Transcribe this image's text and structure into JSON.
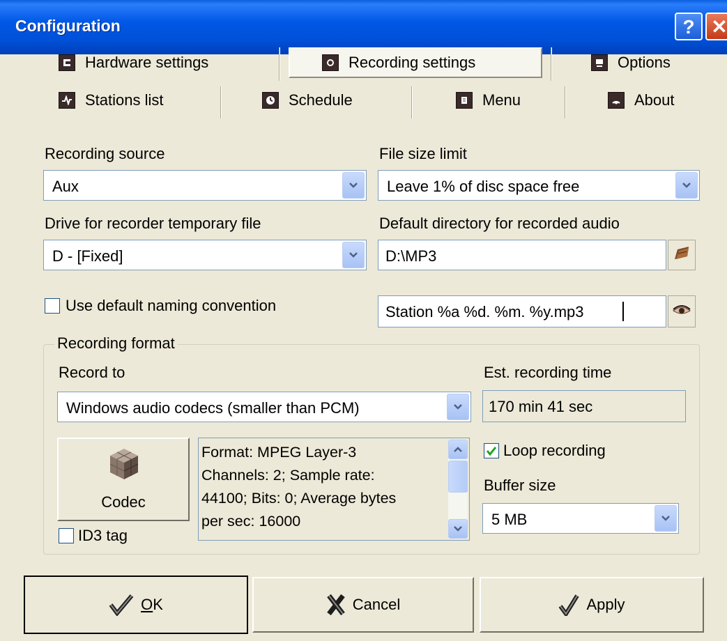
{
  "window": {
    "title": "Configuration",
    "help_glyph": "?",
    "close_glyph": "✕"
  },
  "tabs": [
    {
      "label": "Hardware settings",
      "icon": "hardware-icon",
      "active": false
    },
    {
      "label": "Recording settings",
      "icon": "record-icon",
      "active": true
    },
    {
      "label": "Options",
      "icon": "monitor-icon",
      "active": false
    },
    {
      "label": "Stations list",
      "icon": "pulse-icon",
      "active": false
    },
    {
      "label": "Schedule",
      "icon": "clock-icon",
      "active": false
    },
    {
      "label": "Menu",
      "icon": "menu-icon",
      "active": false
    },
    {
      "label": "About",
      "icon": "signal-icon",
      "active": false
    }
  ],
  "recording_source": {
    "label": "Recording source",
    "value": "Aux"
  },
  "file_size_limit": {
    "label": "File size limit",
    "value": "Leave 1% of disc space free"
  },
  "temp_drive": {
    "label": "Drive for recorder temporary file",
    "value": "D - [Fixed]"
  },
  "default_directory": {
    "label": "Default directory for recorded audio",
    "value": "D:\\MP3"
  },
  "naming": {
    "checkbox_label": "Use default naming convention",
    "checked": false,
    "pattern": "Station %a %d. %m. %y.mp3"
  },
  "recording_format": {
    "group_title": "Recording format",
    "record_to_label": "Record to",
    "record_to_value": "Windows audio codecs (smaller than PCM)",
    "est_time_label": "Est. recording time",
    "est_time_value": "170 min 41 sec",
    "codec_button": "Codec",
    "id3_label": "ID3 tag",
    "id3_checked": false,
    "format_info": [
      "Format: MPEG Layer-3",
      "Channels: 2; Sample rate:",
      "44100; Bits: 0; Average bytes",
      "per sec: 16000"
    ],
    "loop_label": "Loop recording",
    "loop_checked": true,
    "buffer_label": "Buffer size",
    "buffer_value": "5 MB"
  },
  "buttons": {
    "ok_rest": "K",
    "ok_mnemonic": "O",
    "cancel": "Cancel",
    "apply": "Apply"
  },
  "colors": {
    "title_bar": "#0054e3",
    "face": "#ece9d8",
    "check_green": "#21a121"
  }
}
